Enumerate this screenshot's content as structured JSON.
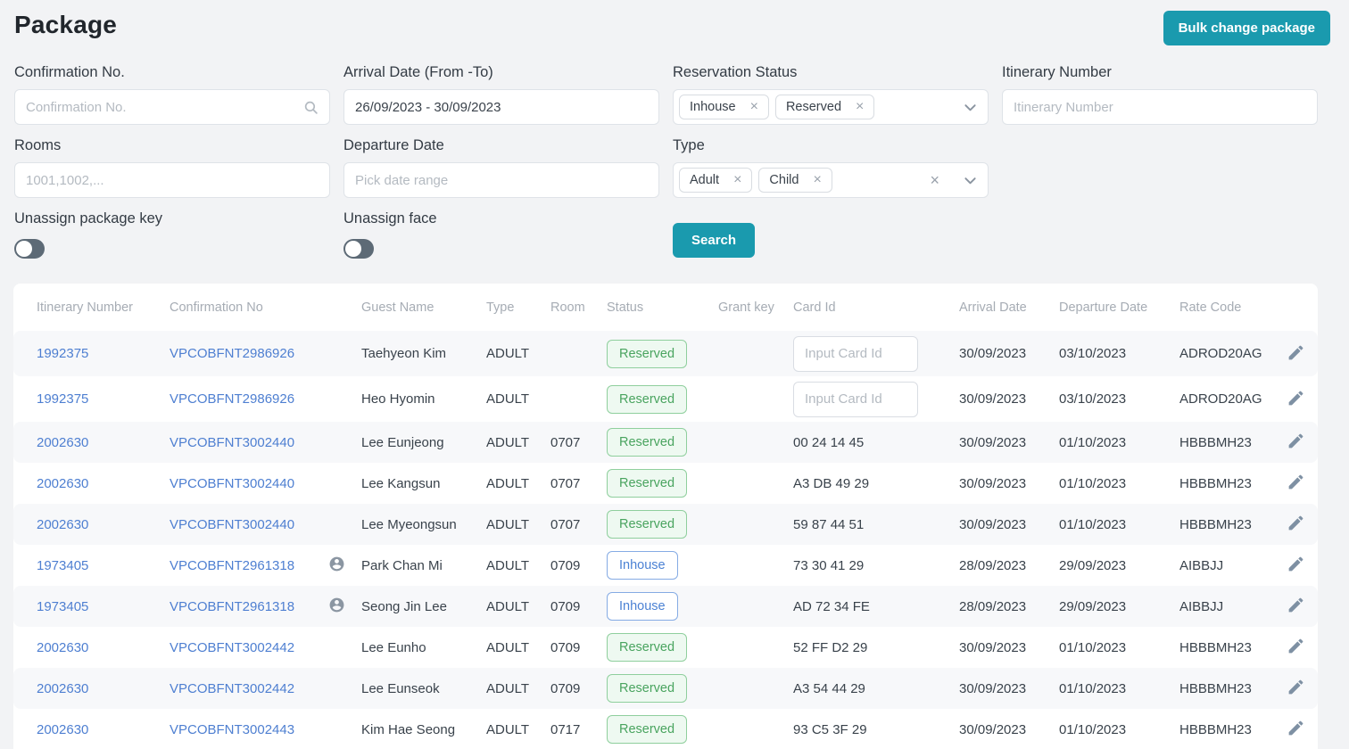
{
  "page": {
    "title": "Package"
  },
  "colors": {
    "accent_teal": "#1a9aae",
    "link_blue": "#4e7fd1",
    "reserved_green": "#49a45f",
    "inhouse_blue": "#4c82d4"
  },
  "header": {
    "bulk_button_label": "Bulk change package"
  },
  "filters": {
    "confirmation": {
      "label": "Confirmation No.",
      "placeholder": "Confirmation No."
    },
    "arrival": {
      "label": "Arrival Date (From -To)",
      "value": "26/09/2023 - 30/09/2023"
    },
    "reservation_status": {
      "label": "Reservation Status",
      "tags": [
        "Inhouse",
        "Reserved"
      ]
    },
    "itinerary": {
      "label": "Itinerary Number",
      "placeholder": "Itinerary Number"
    },
    "rooms": {
      "label": "Rooms",
      "placeholder": "1001,1002,..."
    },
    "departure": {
      "label": "Departure Date",
      "placeholder": "Pick date range"
    },
    "type": {
      "label": "Type",
      "tags": [
        "Adult",
        "Child"
      ]
    },
    "unassign_package_key": {
      "label": "Unassign package key",
      "on": false
    },
    "unassign_face": {
      "label": "Unassign face",
      "on": false
    },
    "search_label": "Search"
  },
  "table": {
    "columns": [
      "Itinerary Number",
      "Confirmation No",
      "Guest Name",
      "Type",
      "Room",
      "Status",
      "Grant key",
      "Card Id",
      "Arrival Date",
      "Departure Date",
      "Rate Code"
    ],
    "card_id_placeholder": "Input Card Id",
    "rows": [
      {
        "itinerary": "1992375",
        "confirmation": "VPCOBFNT2986926",
        "avatar": false,
        "guest": "Taehyeon Kim",
        "type": "ADULT",
        "room": "",
        "status": "Reserved",
        "grant_key": "",
        "card_input": true,
        "card_id": "",
        "arrival": "30/09/2023",
        "departure": "03/10/2023",
        "rate": "ADROD20AG"
      },
      {
        "itinerary": "1992375",
        "confirmation": "VPCOBFNT2986926",
        "avatar": false,
        "guest": "Heo Hyomin",
        "type": "ADULT",
        "room": "",
        "status": "Reserved",
        "grant_key": "",
        "card_input": true,
        "card_id": "",
        "arrival": "30/09/2023",
        "departure": "03/10/2023",
        "rate": "ADROD20AG"
      },
      {
        "itinerary": "2002630",
        "confirmation": "VPCOBFNT3002440",
        "avatar": false,
        "guest": "Lee Eunjeong",
        "type": "ADULT",
        "room": "0707",
        "status": "Reserved",
        "grant_key": "",
        "card_input": false,
        "card_id": "00 24 14 45",
        "arrival": "30/09/2023",
        "departure": "01/10/2023",
        "rate": "HBBBMH23"
      },
      {
        "itinerary": "2002630",
        "confirmation": "VPCOBFNT3002440",
        "avatar": false,
        "guest": "Lee Kangsun",
        "type": "ADULT",
        "room": "0707",
        "status": "Reserved",
        "grant_key": "",
        "card_input": false,
        "card_id": "A3 DB 49 29",
        "arrival": "30/09/2023",
        "departure": "01/10/2023",
        "rate": "HBBBMH23"
      },
      {
        "itinerary": "2002630",
        "confirmation": "VPCOBFNT3002440",
        "avatar": false,
        "guest": "Lee Myeongsun",
        "type": "ADULT",
        "room": "0707",
        "status": "Reserved",
        "grant_key": "",
        "card_input": false,
        "card_id": "59 87 44 51",
        "arrival": "30/09/2023",
        "departure": "01/10/2023",
        "rate": "HBBBMH23"
      },
      {
        "itinerary": "1973405",
        "confirmation": "VPCOBFNT2961318",
        "avatar": true,
        "guest": "Park Chan Mi",
        "type": "ADULT",
        "room": "0709",
        "status": "Inhouse",
        "grant_key": "",
        "card_input": false,
        "card_id": "73 30 41 29",
        "arrival": "28/09/2023",
        "departure": "29/09/2023",
        "rate": "AIBBJJ"
      },
      {
        "itinerary": "1973405",
        "confirmation": "VPCOBFNT2961318",
        "avatar": true,
        "guest": "Seong Jin Lee",
        "type": "ADULT",
        "room": "0709",
        "status": "Inhouse",
        "grant_key": "",
        "card_input": false,
        "card_id": "AD 72 34 FE",
        "arrival": "28/09/2023",
        "departure": "29/09/2023",
        "rate": "AIBBJJ"
      },
      {
        "itinerary": "2002630",
        "confirmation": "VPCOBFNT3002442",
        "avatar": false,
        "guest": "Lee Eunho",
        "type": "ADULT",
        "room": "0709",
        "status": "Reserved",
        "grant_key": "",
        "card_input": false,
        "card_id": "52 FF D2 29",
        "arrival": "30/09/2023",
        "departure": "01/10/2023",
        "rate": "HBBBMH23"
      },
      {
        "itinerary": "2002630",
        "confirmation": "VPCOBFNT3002442",
        "avatar": false,
        "guest": "Lee Eunseok",
        "type": "ADULT",
        "room": "0709",
        "status": "Reserved",
        "grant_key": "",
        "card_input": false,
        "card_id": "A3 54 44 29",
        "arrival": "30/09/2023",
        "departure": "01/10/2023",
        "rate": "HBBBMH23"
      },
      {
        "itinerary": "2002630",
        "confirmation": "VPCOBFNT3002443",
        "avatar": false,
        "guest": "Kim Hae Seong",
        "type": "ADULT",
        "room": "0717",
        "status": "Reserved",
        "grant_key": "",
        "card_input": false,
        "card_id": "93 C5 3F 29",
        "arrival": "30/09/2023",
        "departure": "01/10/2023",
        "rate": "HBBBMH23"
      }
    ]
  }
}
